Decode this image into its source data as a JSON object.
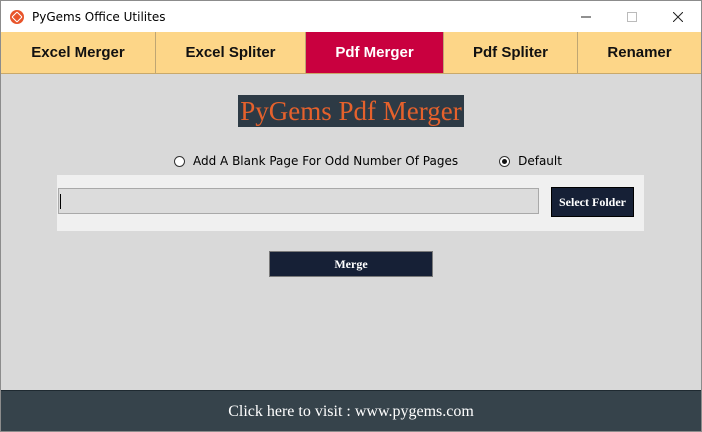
{
  "window": {
    "title": "PyGems Office Utilites",
    "controls": [
      "minimize",
      "maximize",
      "close"
    ]
  },
  "tabs": [
    {
      "label": "Excel Merger",
      "active": false
    },
    {
      "label": "Excel Spliter",
      "active": false
    },
    {
      "label": "Pdf Merger",
      "active": true
    },
    {
      "label": "Pdf Spliter",
      "active": false
    },
    {
      "label": "Renamer",
      "active": false
    }
  ],
  "main": {
    "heading": "PyGems Pdf Merger",
    "options": [
      {
        "label": "Add A Blank Page For Odd Number Of Pages",
        "selected": false
      },
      {
        "label": "Default",
        "selected": true
      }
    ],
    "folder_path": "",
    "select_folder_label": "Select Folder",
    "merge_label": "Merge"
  },
  "footer": {
    "link_text": "Click here to visit : www.pygems.com"
  },
  "colors": {
    "tab_bar": "#fdd688",
    "active_tab": "#c9003f",
    "heading_bg": "#2d3a45",
    "heading_text": "#e5612c",
    "button_bg": "#162036",
    "footer_bg": "#36434b",
    "content_bg": "#d9d9d9"
  }
}
